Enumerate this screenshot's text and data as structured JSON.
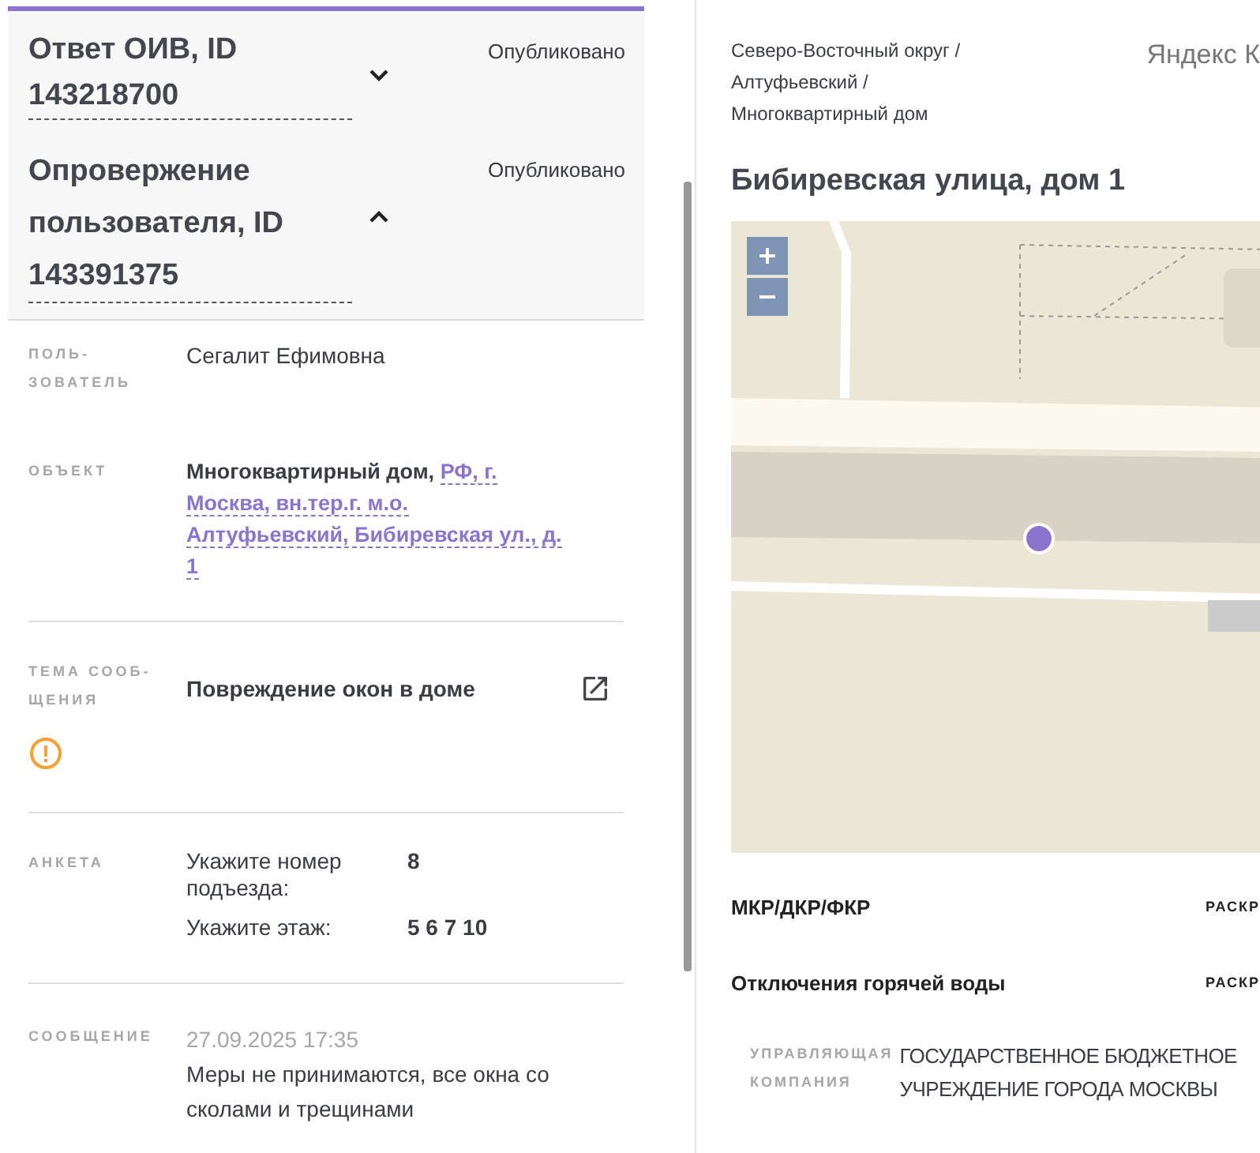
{
  "responses": [
    {
      "title_lines": [
        "Ответ ОИВ, ID",
        "143218700"
      ],
      "status": "Опубликовано",
      "expanded": false
    },
    {
      "title_lines": [
        "Опровержение",
        "пользователя, ID",
        "143391375"
      ],
      "status": "Опубликовано",
      "expanded": true
    }
  ],
  "fields": [
    {
      "kind": "text",
      "label": "ПОЛЬ-\nЗОВАТЕЛЬ",
      "value": "Сегалит Ефимовна"
    },
    {
      "kind": "object",
      "label": "ОБЪЕКТ",
      "prefix": "Многоквартирный дом,",
      "link_lines": [
        "РФ, г.",
        "Москва, вн.тер.г. м.о.",
        "Алтуфьевский, Бибиревская ул., д.",
        "1"
      ]
    },
    {
      "kind": "topic",
      "label": "ТЕМА СООБ-\nЩЕНИЯ",
      "value": "Повреждение окон в доме",
      "warning": true
    },
    {
      "kind": "survey",
      "label": "АНКЕТА",
      "answers": [
        {
          "question": "Укажите номер подъезда:",
          "answer": "8"
        },
        {
          "question": "Укажите этаж:",
          "answer": "5 6 7 10"
        }
      ]
    },
    {
      "kind": "message",
      "label": "СООБЩЕНИЕ",
      "date": "27.09.2025 17:35",
      "value": "Меры не принимаются, все окна со сколами и трещинами"
    }
  ],
  "building": {
    "breadcrumbs": [
      "Северо-Восточный округ /",
      "Алтуфьевский /",
      "Многоквартирный дом"
    ],
    "source": "Яндекс К",
    "title": "Бибиревская улица, дом 1",
    "sections": [
      {
        "title": "МКР/ДКР/ФКР",
        "action": "РАСКР"
      },
      {
        "title": "Отключения горячей воды",
        "action": "РАСКР"
      }
    ],
    "company": {
      "label": "УПРАВЛЯЮЩАЯ КОМПАНИЯ",
      "value": "ГОСУДАРСТВЕННОЕ БЮДЖЕТНОЕ УЧРЕЖДЕНИЕ ГОРОДА МОСКВЫ"
    }
  }
}
